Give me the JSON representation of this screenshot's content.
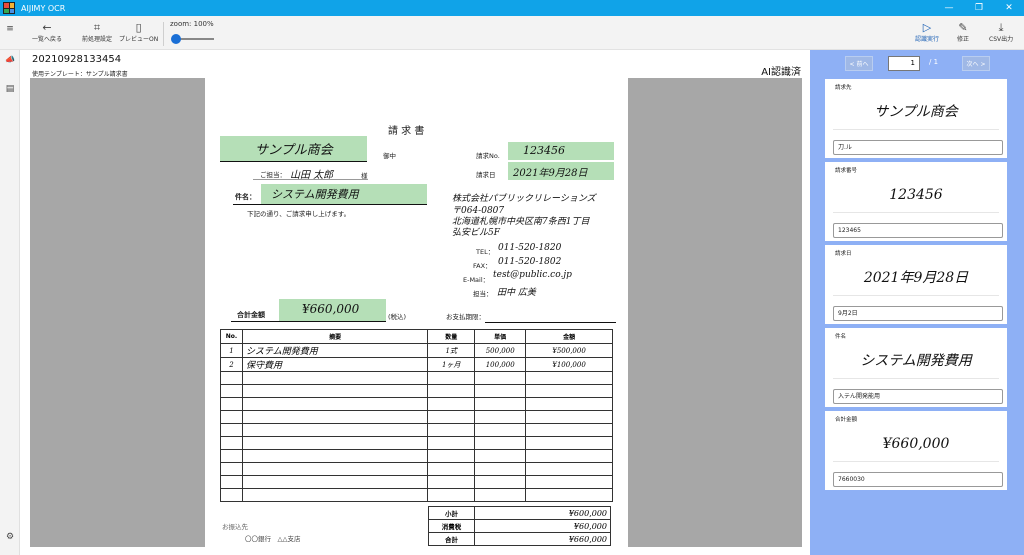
{
  "window": {
    "title": "AIJIMY OCR",
    "controls": [
      "—",
      "❐",
      "✕"
    ]
  },
  "toolbar": {
    "back_label": "一覧へ戻る",
    "preprocess_label": "前処理設定",
    "preview_label": "プレビューON",
    "zoom_label": "zoom: 100%",
    "zoom_value": 100,
    "recognize_label": "認識実行",
    "edit_label": "修正",
    "csv_label": "CSV出力"
  },
  "icons": {
    "back": "←",
    "crop": "⌗",
    "page": "▯",
    "run": "▷",
    "pen": "✎",
    "download": "⤓",
    "menu": "≡",
    "megaphone": "📣",
    "doc": "▤",
    "gear": "⚙"
  },
  "document": {
    "id": "20210928133454",
    "template": "使用テンプレート：サンプル請求書",
    "status": "AI認識済"
  },
  "invoice": {
    "title": "請 求 書",
    "to_name": "サンプル商会",
    "to_suffix": "御中",
    "contact_label": "ご担当：",
    "contact_name": "山田 太郎",
    "contact_honorific": "様",
    "subject_label": "件名：",
    "subject": "システム開発費用",
    "intro": "下記の通り、ご請求申し上げます。",
    "no_label": "請求No.",
    "no_value": "123456",
    "date_label": "請求日",
    "date_value": "2021年9月28日",
    "issuer_company": "株式会社パブリックリレーションズ",
    "issuer_zip": "〒064-0807",
    "issuer_address": "北海道札幌市中央区南7条西1丁目",
    "issuer_building": "弘安ビル5F",
    "tel_label": "TEL：",
    "tel_value": "011-520-1820",
    "fax_label": "FAX：",
    "fax_value": "011-520-1802",
    "email_label": "E-Mail：",
    "email_value": "test@public.co.jp",
    "rep_label": "担当：",
    "rep_value": "田中 広美",
    "total_label": "合計金額",
    "total_value": "¥660,000",
    "tax_note": "(税込)",
    "due_label": "お支払期限：",
    "table_headers": [
      "No.",
      "摘要",
      "数量",
      "単価",
      "金額"
    ],
    "rows": [
      {
        "no": "1",
        "desc": "システム開発費用",
        "qty": "1式",
        "unit": "500,000",
        "amount": "¥500,000"
      },
      {
        "no": "2",
        "desc": "保守費用",
        "qty": "1ヶ月",
        "unit": "100,000",
        "amount": "¥100,000"
      },
      {
        "no": "",
        "desc": "",
        "qty": "",
        "unit": "",
        "amount": ""
      },
      {
        "no": "",
        "desc": "",
        "qty": "",
        "unit": "",
        "amount": ""
      },
      {
        "no": "",
        "desc": "",
        "qty": "",
        "unit": "",
        "amount": ""
      },
      {
        "no": "",
        "desc": "",
        "qty": "",
        "unit": "",
        "amount": ""
      },
      {
        "no": "",
        "desc": "",
        "qty": "",
        "unit": "",
        "amount": ""
      },
      {
        "no": "",
        "desc": "",
        "qty": "",
        "unit": "",
        "amount": ""
      },
      {
        "no": "",
        "desc": "",
        "qty": "",
        "unit": "",
        "amount": ""
      },
      {
        "no": "",
        "desc": "",
        "qty": "",
        "unit": "",
        "amount": ""
      },
      {
        "no": "",
        "desc": "",
        "qty": "",
        "unit": "",
        "amount": ""
      },
      {
        "no": "",
        "desc": "",
        "qty": "",
        "unit": "",
        "amount": ""
      }
    ],
    "subtotal_label": "小計",
    "subtotal_value": "¥600,000",
    "tax_label": "消費税",
    "tax_value": "¥60,000",
    "grand_label": "合計",
    "grand_value": "¥660,000",
    "bank_label": "お振込先",
    "bank_value": "〇〇銀行　△△支店"
  },
  "pager": {
    "prev_label": "< 前へ",
    "next_label": "次へ >",
    "current": "1",
    "total": "/ 1"
  },
  "fields": [
    {
      "label": "請求先",
      "image_text": "サンプル商会",
      "ocr_value": "刀.ル"
    },
    {
      "label": "請求番号",
      "image_text": "123456",
      "ocr_value": "123465"
    },
    {
      "label": "請求日",
      "image_text": "2021年9月28日",
      "ocr_value": "9月2日"
    },
    {
      "label": "件名",
      "image_text": "システム開発費用",
      "ocr_value": "入テん開発能用"
    },
    {
      "label": "合計金額",
      "image_text": "¥660,000",
      "ocr_value": "7660030"
    }
  ],
  "colors": {
    "titlebar": "#10a3e8",
    "highlight": "#b5dfb7",
    "panel": "#8eb0f5",
    "accent": "#1a5fb4"
  }
}
